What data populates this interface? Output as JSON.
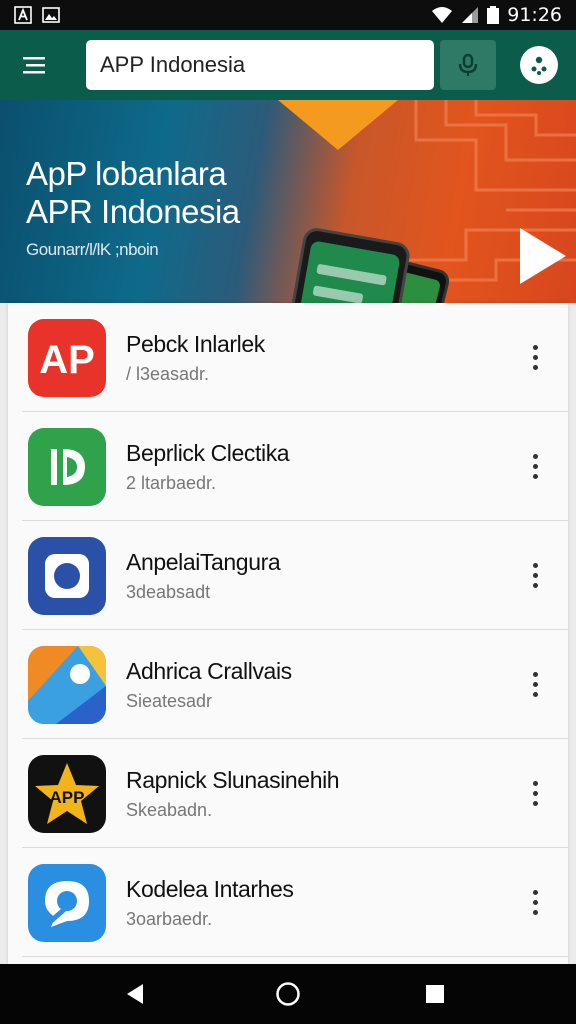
{
  "status_bar": {
    "time": "91:26",
    "left_icons": [
      "text-a-icon",
      "image-icon"
    ],
    "right_icons": [
      "wifi-icon",
      "signal-icon",
      "battery-icon"
    ]
  },
  "app_bar": {
    "menu_icon": "hamburger-menu-icon",
    "search_value": "APP Indonesia",
    "mic_icon": "mic-icon",
    "avatar_icon": "account-icon"
  },
  "banner": {
    "title_line1": "ApP lobanlara",
    "title_line2": "APR Indonesia",
    "subtitle": "Gounarr/l/lK ;nboin",
    "play_icon": "play-icon",
    "fab_icon": "arrow-icon"
  },
  "apps": [
    {
      "title": "Pebck Inlarlek",
      "subtitle": "/ l3easadr.",
      "icon": "ap-red-icon",
      "color": "#e8332a"
    },
    {
      "title": "Beprlick Clectika",
      "subtitle": "2 ltarbaedr.",
      "icon": "green-d-icon",
      "color": "#2fa24b"
    },
    {
      "title": "AnpelaiTangura",
      "subtitle": "3deabsadt",
      "icon": "camera-blue-icon",
      "color": "#2b50a8"
    },
    {
      "title": "Adhrica Crallvais",
      "subtitle": "Sieatesadr",
      "icon": "map-colorful-icon",
      "color": "#f08a24"
    },
    {
      "title": "Rapnick Slunasinehih",
      "subtitle": "Skeabadn.",
      "icon": "app-star-icon",
      "color": "#111111"
    },
    {
      "title": "Kodelea Intarhes",
      "subtitle": "3oarbaedr.",
      "icon": "chat-blue-icon",
      "color": "#2a8fe0"
    }
  ],
  "nav_bar": {
    "back_icon": "back-icon",
    "home_icon": "home-icon",
    "recents_icon": "recents-icon"
  },
  "colors": {
    "app_bar": "#0b5c4a",
    "accent": "#2a6fd6"
  }
}
